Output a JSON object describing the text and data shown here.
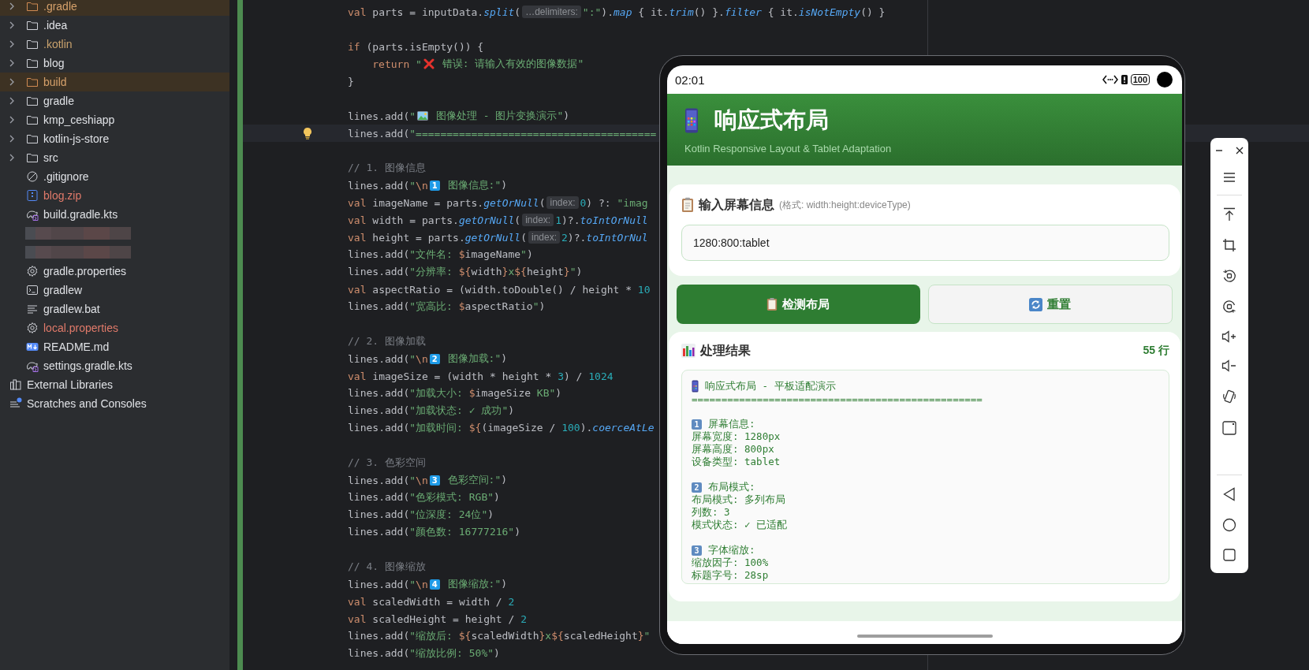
{
  "project_tree": [
    {
      "label": ".gradle",
      "kind": "folder",
      "color": "#d5a06a",
      "highlighted": true,
      "expanded": false
    },
    {
      "label": ".idea",
      "kind": "folder",
      "color": "#dfe1e5",
      "highlighted": false,
      "expanded": false
    },
    {
      "label": ".kotlin",
      "kind": "folder",
      "color": "#c9a26d",
      "highlighted": false,
      "expanded": false
    },
    {
      "label": "blog",
      "kind": "folder",
      "color": "#dfe1e5",
      "highlighted": false,
      "expanded": false
    },
    {
      "label": "build",
      "kind": "folder",
      "color": "#d5a06a",
      "highlighted": true,
      "expanded": false
    },
    {
      "label": "gradle",
      "kind": "folder",
      "color": "#dfe1e5",
      "highlighted": false,
      "expanded": false
    },
    {
      "label": "kmp_ceshiapp",
      "kind": "folder",
      "color": "#dfe1e5",
      "highlighted": false,
      "expanded": false
    },
    {
      "label": "kotlin-js-store",
      "kind": "folder",
      "color": "#dfe1e5",
      "highlighted": false,
      "expanded": false
    },
    {
      "label": "src",
      "kind": "folder",
      "color": "#dfe1e5",
      "highlighted": false,
      "expanded": false
    },
    {
      "label": ".gitignore",
      "kind": "ignore-file",
      "color": "#dfe1e5",
      "highlighted": false
    },
    {
      "label": "blog.zip",
      "kind": "archive",
      "color": "#e07a6a",
      "highlighted": false
    },
    {
      "label": "build.gradle.kts",
      "kind": "gradle-script",
      "color": "#dfe1e5",
      "highlighted": false
    },
    {
      "kind": "redacted"
    },
    {
      "kind": "redacted"
    },
    {
      "label": "gradle.properties",
      "kind": "settings",
      "color": "#dfe1e5",
      "highlighted": false
    },
    {
      "label": "gradlew",
      "kind": "terminal",
      "color": "#dfe1e5",
      "highlighted": false
    },
    {
      "label": "gradlew.bat",
      "kind": "text",
      "color": "#dfe1e5",
      "highlighted": false
    },
    {
      "label": "local.properties",
      "kind": "settings",
      "color": "#e07a6a",
      "highlighted": false
    },
    {
      "label": "README.md",
      "kind": "markdown",
      "color": "#dfe1e5",
      "highlighted": false
    },
    {
      "label": "settings.gradle.kts",
      "kind": "gradle-script",
      "color": "#dfe1e5",
      "highlighted": false
    }
  ],
  "other_nodes": [
    {
      "label": "External Libraries",
      "kind": "libraries"
    },
    {
      "label": "Scratches and Consoles",
      "kind": "scratches"
    }
  ],
  "code_lines": [
    {
      "current": false,
      "parts": [
        {
          "kind": "code",
          "text": "val parts = inputData.split("
        },
        {
          "kind": "hint",
          "text": "…delimiters:"
        },
        {
          "kind": "code",
          "text": "\":\").map { it.trim() }.filter { it.isNotEmpty() }"
        }
      ]
    },
    {
      "current": false
    },
    {
      "current": false,
      "parts": [
        {
          "kind": "code",
          "text": "if (parts.isEmpty()) {"
        }
      ],
      "children": [
        {
          "current": false,
          "parts": [
            {
              "kind": "code",
              "text": "return \""
            },
            {
              "kind": "cross"
            },
            {
              "kind": "code",
              "text": " 错误: 请输入有效的图像数据\""
            }
          ]
        }
      ]
    },
    {
      "current": false,
      "parts": [
        {
          "kind": "code",
          "text": "}"
        }
      ]
    },
    {
      "current": false
    },
    {
      "current": false,
      "parts": [
        {
          "kind": "code",
          "text": "lines.add(\""
        },
        {
          "kind": "image"
        },
        {
          "kind": "code",
          "text": " 图像处理 - 图片变换演示\")"
        }
      ]
    },
    {
      "current": true,
      "parts": [
        {
          "kind": "code",
          "text": "lines.add(\"======================================="
        }
      ]
    },
    {
      "current": false
    },
    {
      "current": false,
      "parts": [
        {
          "kind": "code",
          "text": "// 1. 图像信息"
        }
      ]
    },
    {
      "current": false,
      "parts": [
        {
          "kind": "code",
          "text": "lines.add(\"\\n"
        },
        {
          "kind": "keycap",
          "text": "1"
        },
        {
          "kind": "code",
          "text": " 图像信息:\")"
        }
      ]
    },
    {
      "current": false,
      "parts": [
        {
          "kind": "code",
          "text": "val imageName = parts.getOrNull("
        },
        {
          "kind": "hint",
          "text": "index:"
        },
        {
          "kind": "code",
          "text": "0) ?: \"imag"
        }
      ]
    },
    {
      "current": false,
      "parts": [
        {
          "kind": "code",
          "text": "val width = parts.getOrNull("
        },
        {
          "kind": "hint",
          "text": "index:"
        },
        {
          "kind": "code",
          "text": "1)?.toIntOrNull"
        }
      ]
    },
    {
      "current": false,
      "parts": [
        {
          "kind": "code",
          "text": "val height = parts.getOrNull("
        },
        {
          "kind": "hint",
          "text": "index:"
        },
        {
          "kind": "code",
          "text": "2)?.toIntOrNul"
        }
      ]
    },
    {
      "current": false,
      "parts": [
        {
          "kind": "code",
          "text": "lines.add(\"文件名: $imageName\")"
        }
      ]
    },
    {
      "current": false,
      "parts": [
        {
          "kind": "code",
          "text": "lines.add(\"分辨率: ${width}x${height}\")"
        }
      ]
    },
    {
      "current": false,
      "parts": [
        {
          "kind": "code",
          "text": "val aspectRatio = (width.toDouble() / height * 10"
        }
      ]
    },
    {
      "current": false,
      "parts": [
        {
          "kind": "code",
          "text": "lines.add(\"宽高比: $aspectRatio\")"
        }
      ]
    },
    {
      "current": false
    },
    {
      "current": false,
      "parts": [
        {
          "kind": "code",
          "text": "// 2. 图像加载"
        }
      ]
    },
    {
      "current": false,
      "parts": [
        {
          "kind": "code",
          "text": "lines.add(\"\\n"
        },
        {
          "kind": "keycap",
          "text": "2"
        },
        {
          "kind": "code",
          "text": " 图像加载:\")"
        }
      ]
    },
    {
      "current": false,
      "parts": [
        {
          "kind": "code",
          "text": "val imageSize = (width * height * 3) / 1024"
        }
      ]
    },
    {
      "current": false,
      "parts": [
        {
          "kind": "code",
          "text": "lines.add(\"加载大小: $imageSize KB\")"
        }
      ]
    },
    {
      "current": false,
      "parts": [
        {
          "kind": "code",
          "text": "lines.add(\"加载状态: ✓ 成功\")"
        }
      ]
    },
    {
      "current": false,
      "parts": [
        {
          "kind": "code",
          "text": "lines.add(\"加载时间: ${(imageSize / 100).coerceAtLe"
        }
      ]
    },
    {
      "current": false
    },
    {
      "current": false,
      "parts": [
        {
          "kind": "code",
          "text": "// 3. 色彩空间"
        }
      ]
    },
    {
      "current": false,
      "parts": [
        {
          "kind": "code",
          "text": "lines.add(\"\\n"
        },
        {
          "kind": "keycap",
          "text": "3"
        },
        {
          "kind": "code",
          "text": " 色彩空间:\")"
        }
      ]
    },
    {
      "current": false,
      "parts": [
        {
          "kind": "code",
          "text": "lines.add(\"色彩模式: RGB\")"
        }
      ]
    },
    {
      "current": false,
      "parts": [
        {
          "kind": "code",
          "text": "lines.add(\"位深度: 24位\")"
        }
      ]
    },
    {
      "current": false,
      "parts": [
        {
          "kind": "code",
          "text": "lines.add(\"颜色数: 16777216\")"
        }
      ]
    },
    {
      "current": false
    },
    {
      "current": false,
      "parts": [
        {
          "kind": "code",
          "text": "// 4. 图像缩放"
        }
      ]
    },
    {
      "current": false,
      "parts": [
        {
          "kind": "code",
          "text": "lines.add(\"\\n"
        },
        {
          "kind": "keycap",
          "text": "4"
        },
        {
          "kind": "code",
          "text": " 图像缩放:\")"
        }
      ]
    },
    {
      "current": false,
      "parts": [
        {
          "kind": "code",
          "text": "val scaledWidth = width / 2"
        }
      ]
    },
    {
      "current": false,
      "parts": [
        {
          "kind": "code",
          "text": "val scaledHeight = height / 2"
        }
      ]
    },
    {
      "current": false,
      "parts": [
        {
          "kind": "code",
          "text": "lines.add(\"缩放后: ${scaledWidth}x${scaledHeight}\""
        }
      ]
    },
    {
      "current": false,
      "parts": [
        {
          "kind": "code",
          "text": "lines.add(\"缩放比例: 50%\")"
        }
      ]
    }
  ],
  "phone": {
    "status_bar": {
      "time": "02:01",
      "battery": "100"
    },
    "header": {
      "title": "响应式布局",
      "subtitle": "Kotlin Responsive Layout & Tablet Adaptation"
    },
    "input_card": {
      "title": "输入屏幕信息",
      "hint": "(格式: width:height:deviceType)",
      "value": "1280:800:tablet"
    },
    "buttons": [
      {
        "label": "检测布局",
        "kind": "primary"
      },
      {
        "label": "重置",
        "kind": "secondary"
      }
    ],
    "result_card": {
      "title": "处理结果",
      "count": "55 行",
      "lines": [
        {
          "kind": "phone",
          "text": "响应式布局 - 平板适配演示"
        },
        {
          "kind": "text",
          "text": "================================================="
        },
        {
          "kind": "blank"
        },
        {
          "kind": "badge",
          "badge": "1",
          "text": "屏幕信息:"
        },
        {
          "kind": "text",
          "text": "屏幕宽度: 1280px"
        },
        {
          "kind": "text",
          "text": "屏幕高度: 800px"
        },
        {
          "kind": "text",
          "text": "设备类型: tablet"
        },
        {
          "kind": "blank"
        },
        {
          "kind": "badge",
          "badge": "2",
          "text": "布局模式:"
        },
        {
          "kind": "text",
          "text": "布局模式: 多列布局"
        },
        {
          "kind": "text",
          "text": "列数: 3"
        },
        {
          "kind": "text",
          "text": "模式状态: ✓ 已适配"
        },
        {
          "kind": "blank"
        },
        {
          "kind": "badge",
          "badge": "3",
          "text": "字体缩放:"
        },
        {
          "kind": "text",
          "text": "缩放因子: 100%"
        },
        {
          "kind": "text",
          "text": "标题字号: 28sp"
        }
      ]
    }
  }
}
